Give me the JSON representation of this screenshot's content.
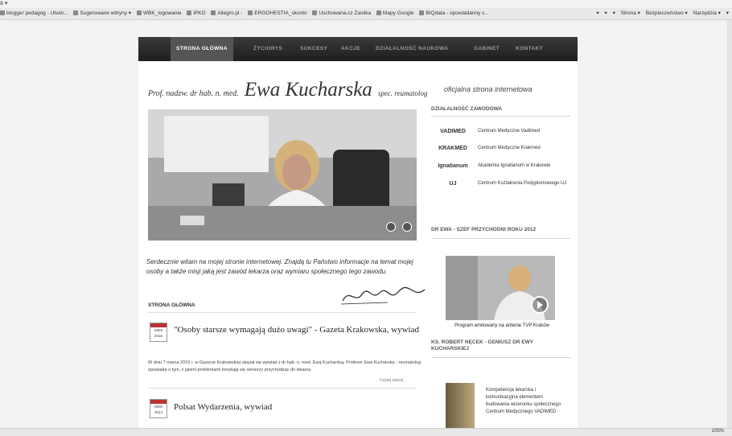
{
  "browser": {
    "top_glyph": "ä ▾",
    "favorites": [
      "blogger pedagog - Utwór...",
      "Sugerowane witryny ▾",
      "WBK_logowanie",
      "iPKO",
      "Allegro.pl -",
      "ERGOHESTIA_skonto",
      "Uschowana.cz Zasilka",
      "Mapy Google",
      "BIQdata - opowiadanny s..."
    ],
    "tools": [
      "▾",
      "▾",
      "▾",
      "Strona ▾",
      "Bezpieczeństwo ▾",
      "Narzędzia ▾",
      "▾"
    ],
    "zoom": "105%"
  },
  "site": {
    "nav": [
      "STRONA GŁÓWNA",
      "ŻYCIORYS",
      "SUKCESY",
      "AKCJE",
      "DZIAŁALNOŚĆ NAUKOWA",
      "GABINET",
      "KONTAKT"
    ],
    "header": {
      "prefix": "Prof. nadzw. dr hab. n. med.",
      "name": "Ewa Kucharska",
      "suffix": "spec. reumatolog",
      "tagline": "oficjalna strona internetowa"
    },
    "welcome": "Serdecznie witam na mojej stronie internetowej. Znajdą tu Państwo informacje na temat mojej osoby a także misji jaką jest zawód lekarza oraz wymiaru społecznego tego zawodu.",
    "signature": "Ewa Kucharska",
    "section": "STRONA GŁÓWNA",
    "articles": [
      {
        "date": "2015",
        "day": "0303",
        "title": "\"Osoby starsze wymagają dużo uwagi\" - Gazeta Krakowska, wywiad",
        "text": "W dniu 7 marca 2015 r. w Gazecie Krakowskiej ukazał się wywiad z dr hab. n. med. Ewą Kucharską, Profesor Ewa Kucharska - reumatolog opowiada o tym, z jakimi problemami borykają się seniorzy przychodząc do lekarza",
        "more": "Czytaj więcej"
      },
      {
        "date": "2014",
        "day": "0000",
        "title": "Polsat Wydarzenia, wywiad"
      }
    ],
    "right": {
      "h1": "DZIAŁALNOŚĆ ZAWODOWA",
      "partners": [
        {
          "logo": "VADIMED",
          "name": "Centrum Medyczne Vadimed"
        },
        {
          "logo": "KRAKMED",
          "name": "Centrum Medyczne Krakmed"
        },
        {
          "logo": "Ignatianum",
          "name": "Akademia Ignatianum w Krakowie"
        },
        {
          "logo": "UJ",
          "name": "Centrum Kształcenia Podyplomowego UJ"
        }
      ],
      "h2": "DR EWA - SZEF PRZYCHODNI ROKU 2012",
      "video_caption": "Program emitowany na antenie TVP Kraków",
      "h3": "KS. ROBERT NĘCEK - GENIUSZ DR EWY KUCHARSKIEJ",
      "book_text": "Kompetencja lekarska i komunikacyjna elementem budowania wizerunku społecznego Centrum Medycznego VADIMED"
    }
  }
}
